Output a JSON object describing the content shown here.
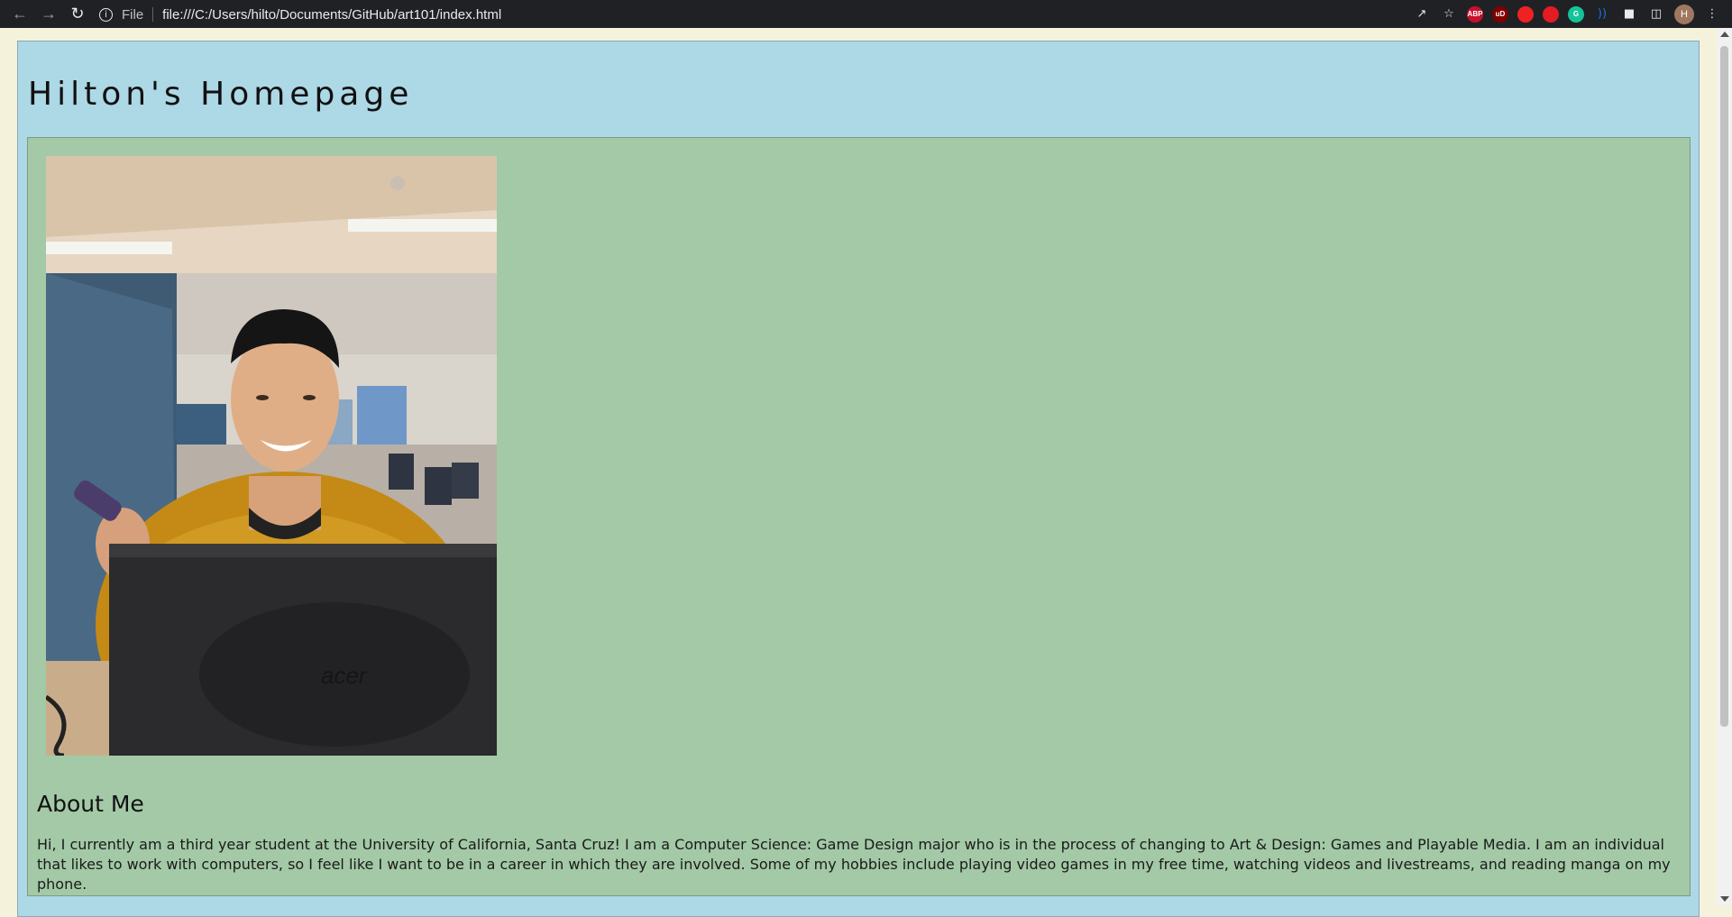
{
  "browser": {
    "file_label": "File",
    "url": "file:///C:/Users/hilto/Documents/GitHub/art101/index.html",
    "avatar_initial": "H",
    "extensions": [
      "ABP",
      "uD",
      "",
      "",
      "G",
      ""
    ]
  },
  "page": {
    "title": "Hilton's Homepage",
    "about_heading": "About Me",
    "about_text": "Hi, I currently am a third year student at the University of California, Santa Cruz! I am a Computer Science: Game Design major who is in the process of changing to Art & Design: Games and Playable Media. I am an individual that likes to work with computers, so I feel like I want to be in a career in which they are involved. Some of my hobbies include playing video games in my free time, watching videos and livestreams, and reading manga on my phone.",
    "photo_logo": "acer"
  },
  "colors": {
    "page_bg": "#add8e6",
    "content_bg": "#a3c9a6",
    "outer_bg": "#f5f2dc"
  }
}
